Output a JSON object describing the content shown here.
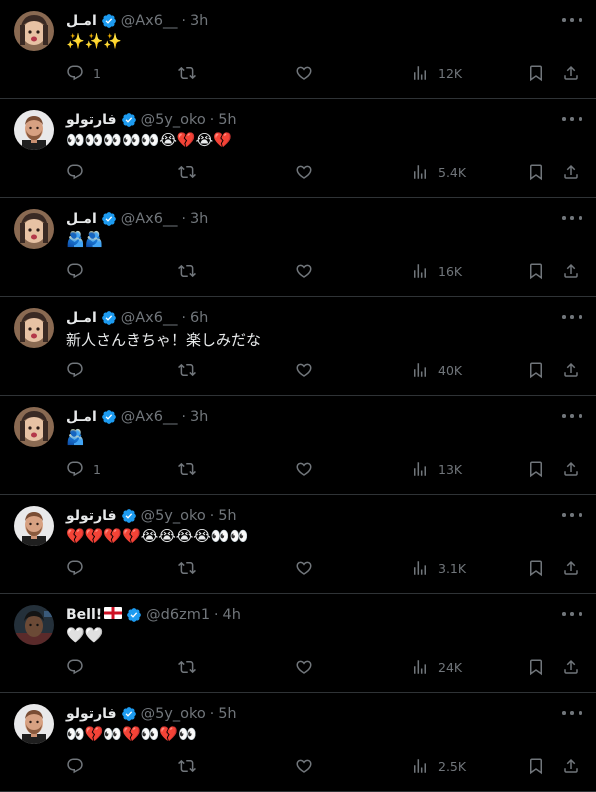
{
  "tweets": [
    {
      "name": "امـل",
      "handle": "@Ax6__",
      "time": "3h",
      "text": "✨✨✨",
      "replies": "1",
      "views": "12K",
      "avatar": "amal"
    },
    {
      "name": "فارتولو",
      "handle": "@5y_oko",
      "time": "5h",
      "text": "👀👀👀👀👀😭💔😭💔",
      "replies": "",
      "views": "5.4K",
      "avatar": "fart"
    },
    {
      "name": "امـل",
      "handle": "@Ax6__",
      "time": "3h",
      "text": "🫂🫂",
      "replies": "",
      "views": "16K",
      "avatar": "amal"
    },
    {
      "name": "امـل",
      "handle": "@Ax6__",
      "time": "6h",
      "text": "新人さんきちゃ！楽しみだな",
      "replies": "",
      "views": "40K",
      "avatar": "amal"
    },
    {
      "name": "امـل",
      "handle": "@Ax6__",
      "time": "3h",
      "text": "🫂",
      "replies": "1",
      "views": "13K",
      "avatar": "amal"
    },
    {
      "name": "فارتولو",
      "handle": "@5y_oko",
      "time": "5h",
      "text": "💔💔💔💔😭😭😭😭👀👀",
      "replies": "",
      "views": "3.1K",
      "avatar": "fart"
    },
    {
      "name": "Bell!",
      "handle": "@d6zm1",
      "time": "4h",
      "text": "🤍🤍",
      "replies": "",
      "views": "24K",
      "avatar": "bell"
    },
    {
      "name": "فارتولو",
      "handle": "@5y_oko",
      "time": "5h",
      "text": "👀💔👀💔👀💔👀",
      "replies": "",
      "views": "2.5K",
      "avatar": "fart"
    }
  ],
  "separator": "·",
  "colors": {
    "background": "#000000",
    "text": "#e7e9ea",
    "muted": "#71767b",
    "verified": "#1d9bf0",
    "border": "#2f3336"
  },
  "icons": {
    "reply": "reply-icon",
    "retweet": "retweet-icon",
    "like": "heart-icon",
    "views": "views-icon",
    "bookmark": "bookmark-icon",
    "share": "share-icon",
    "more": "more-icon",
    "verified": "verified-icon",
    "flag": "england-flag-icon"
  }
}
